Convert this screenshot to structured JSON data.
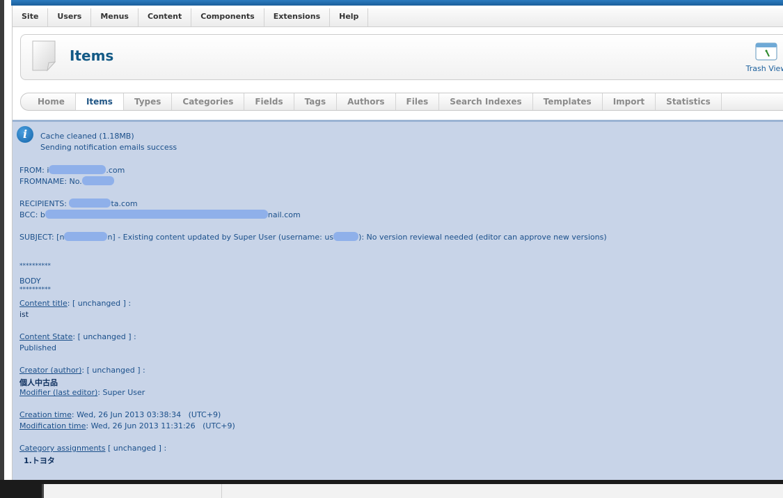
{
  "menu": [
    "Site",
    "Users",
    "Menus",
    "Content",
    "Components",
    "Extensions",
    "Help"
  ],
  "header": {
    "title": "Items",
    "trash_label": "Trash View"
  },
  "tabs": [
    {
      "label": "Home"
    },
    {
      "label": "Items"
    },
    {
      "label": "Types"
    },
    {
      "label": "Categories"
    },
    {
      "label": "Fields"
    },
    {
      "label": "Tags"
    },
    {
      "label": "Authors"
    },
    {
      "label": "Files"
    },
    {
      "label": "Search Indexes"
    },
    {
      "label": "Templates"
    },
    {
      "label": "Import"
    },
    {
      "label": "Statistics"
    }
  ],
  "active_tab": "Items",
  "messages": {
    "cache": "Cache cleaned (1.18MB)",
    "notify": "Sending notification emails success",
    "from_label": "FROM: ",
    "from_pre": "i",
    "from_suffix": ".com",
    "fromname_label": "FROMNAME: ",
    "fromname_pre": "No.",
    "recipients_label": "RECIPIENTS: ",
    "recipients_suffix": "ta.com",
    "bcc_label": "BCC: ",
    "bcc_pre": "b",
    "bcc_suffix": "nail.com",
    "subject_label": "SUBJECT: ",
    "subject_open": "[n",
    "subject_mid": "n] - Existing content updated by Super User (username: us",
    "subject_end": "): No version reviewal needed (editor can approve new versions)",
    "stars": "**********",
    "body": "BODY",
    "content_title_link": "Content title",
    "content_title_status": ": [ unchanged ] :",
    "content_title_value": "ist",
    "content_state_link": "Content State",
    "content_state_status": ": [ unchanged ] :",
    "content_state_value": "Published",
    "creator_link": "Creator (author)",
    "creator_status": ": [ unchanged ] :",
    "creator_value": "個人中古品",
    "modifier_link": "Modifier (last editor)",
    "modifier_value": ": Super User",
    "creation_link": "Creation time",
    "creation_value": ": Wed, 26 Jun 2013 03:38:34   (UTC+9)",
    "modification_link": "Modification time",
    "modification_value": ": Wed, 26 Jun 2013 11:31:26   (UTC+9)",
    "category_link": "Category assignments",
    "category_status": " [ unchanged ] :",
    "category_value": "1.トヨタ"
  },
  "colors": {
    "brand_blue": "#1b5f9c",
    "message_bg": "#c8d4e8",
    "link": "#1a4f8a"
  },
  "icons": [
    "page-icon",
    "trash-view-icon",
    "info-icon"
  ]
}
